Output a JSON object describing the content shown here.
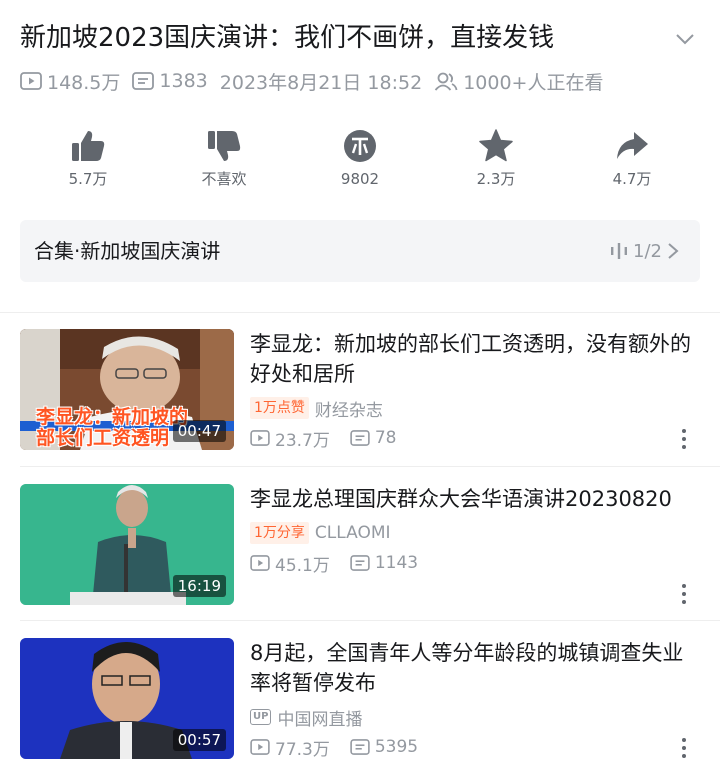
{
  "header": {
    "title": "新加坡2023国庆演讲：我们不画饼，直接发钱"
  },
  "meta": {
    "views": "148.5万",
    "danmaku": "1383",
    "datetime": "2023年8月21日 18:52",
    "watching": "1000+人正在看"
  },
  "actions": {
    "like": "5.7万",
    "dislike": "不喜欢",
    "coin": "9802",
    "favorite": "2.3万",
    "share": "4.7万"
  },
  "collection": {
    "label": "合集·新加坡国庆演讲",
    "progress": "1/2"
  },
  "videos": [
    {
      "title": "李显龙：新加坡的部长们工资透明，没有额外的好处和居所",
      "duration": "00:47",
      "tag": "1万点赞",
      "author": "财经杂志",
      "views": "23.7万",
      "danmaku": "78",
      "thumb_caption": "李显龙：新加坡的部长们工资透明"
    },
    {
      "title": "李显龙总理国庆群众大会华语演讲20230820",
      "duration": "16:19",
      "tag": "1万分享",
      "author": "CLLAOMI",
      "views": "45.1万",
      "danmaku": "1143"
    },
    {
      "title": "8月起，全国青年人等分年龄段的城镇调查失业率将暂停发布",
      "duration": "00:57",
      "up_badge": "UP",
      "author": "中国网直播",
      "views": "77.3万",
      "danmaku": "5395"
    }
  ],
  "colors": {
    "accent_tag": "#ff6633",
    "muted": "#9499a0",
    "text": "#18191c"
  }
}
